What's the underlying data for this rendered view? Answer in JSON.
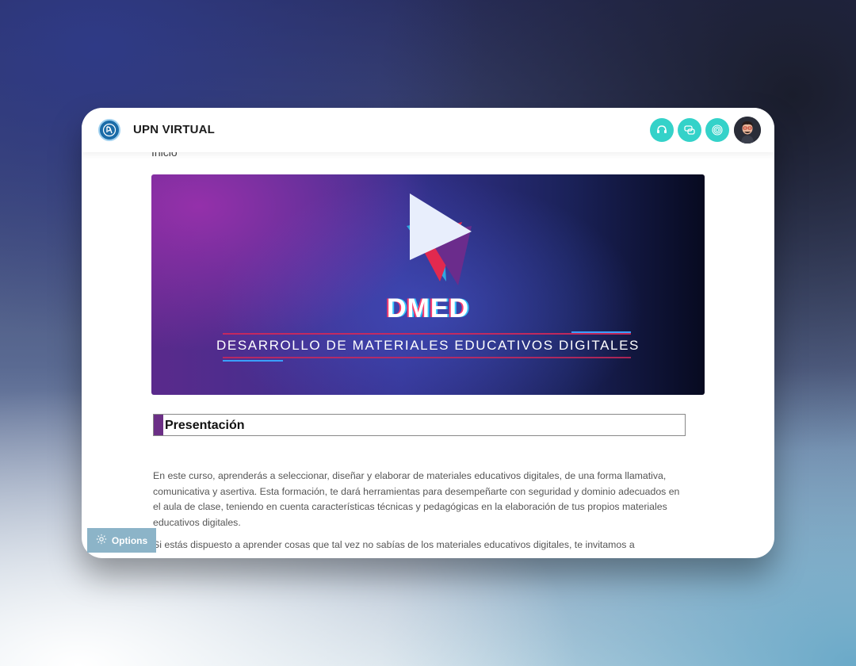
{
  "header": {
    "brand": "UPN VIRTUAL",
    "logo_icon": "upn-logo-icon",
    "actions": [
      {
        "name": "support-icon"
      },
      {
        "name": "chat-icon"
      },
      {
        "name": "fingerprint-icon"
      }
    ],
    "avatar": "user-avatar"
  },
  "breadcrumb": "Inicio",
  "banner": {
    "logo_text": "DMED",
    "subtitle": "DESARROLLO DE MATERIALES EDUCATIVOS DIGITALES"
  },
  "section": {
    "title": "Presentación"
  },
  "paragraphs": [
    "En este curso, aprenderás a seleccionar, diseñar y elaborar de materiales educativos digitales, de una forma llamativa, comunicativa y asertiva. Esta formación, te dará herramientas para desempeñarte con seguridad y dominio adecuados en el aula de clase, teniendo en cuenta características técnicas y pedagógicas en la elaboración de tus propios materiales educativos digitales.",
    "Si estás dispuesto a aprender cosas que tal vez no sabías de los materiales educativos digitales, te invitamos a"
  ],
  "options_button": {
    "label": "Options",
    "icon": "gear-icon"
  },
  "colors": {
    "accent": "#34d2c9",
    "section_bar": "#6b2f86",
    "options_bg": "#8cb4c8"
  }
}
